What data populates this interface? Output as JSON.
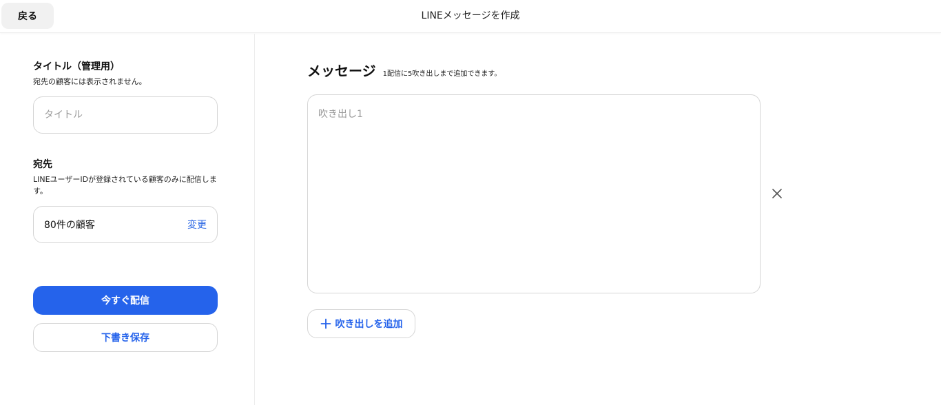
{
  "header": {
    "back_label": "戻る",
    "title": "LINEメッセージを作成"
  },
  "sidebar": {
    "title_section": {
      "heading": "タイトル（管理用）",
      "description": "宛先の顧客には表示されません。",
      "input_value": "",
      "input_placeholder": "タイトル"
    },
    "recipient_section": {
      "heading": "宛先",
      "description": "LINEユーザーIDが登録されている顧客のみに配信します。",
      "recipient_count": "80件の顧客",
      "change_label": "変更"
    },
    "send_now_label": "今すぐ配信",
    "save_draft_label": "下書き保存"
  },
  "main": {
    "heading": "メッセージ",
    "heading_note": "1配信に5吹き出しまで追加できます。",
    "bubbles": [
      {
        "value": "",
        "placeholder": "吹き出し1"
      }
    ],
    "add_bubble_label": "吹き出しを追加"
  },
  "colors": {
    "accent": "#2563eb",
    "link": "#2f6ae5",
    "border": "#d5d5d5",
    "back_button_bg": "#f1f1f1"
  },
  "icons": {
    "remove_bubble": "close-icon",
    "add_bubble": "plus-icon"
  }
}
